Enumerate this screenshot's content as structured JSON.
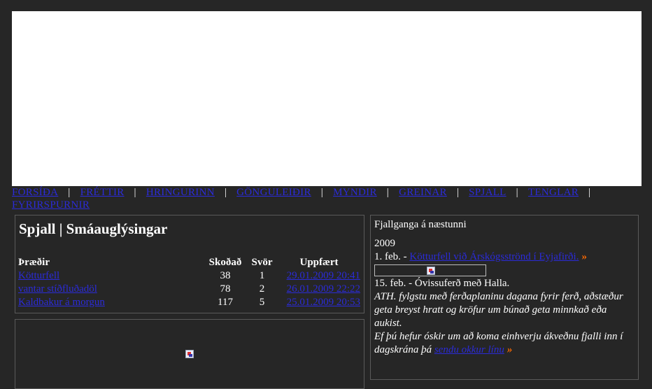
{
  "nav": {
    "items": [
      "FORSÍÐA",
      "FRÉTTIR",
      "HRINGURINN",
      "GÖNGULEIÐIR",
      "MYNDIR",
      "GREINAR",
      "SPJALL",
      "TENGLAR",
      "FYRIRSPURNIR"
    ],
    "separator": "|"
  },
  "forum": {
    "title": "Spjall | Smáauglýsingar",
    "headers": {
      "thread": "Þræðir",
      "views": "Skoðað",
      "replies": "Svör",
      "updated": "Uppfært"
    },
    "rows": [
      {
        "thread": "Kötturfell",
        "views": "38",
        "replies": "1",
        "updated": "29.01.2009 20:41"
      },
      {
        "thread": "vantar stíðfluðadöl",
        "views": "78",
        "replies": "2",
        "updated": "26.01.2009 22:22"
      },
      {
        "thread": "Kaldbakur á morgun",
        "views": "117",
        "replies": "5",
        "updated": "25.01.2009 20:53"
      }
    ]
  },
  "sidebar": {
    "heading": "Fjallganga á næstunni",
    "year": "2009",
    "event1_date": "1. feb. -",
    "event1_link": "Kötturfell við Árskógsströnd í Eyjafirði.",
    "arrow": "»",
    "event2": "15. feb. - Óvissuferð með Halla.",
    "note1": "ATH. fylgstu með ferðaplaninu dagana fyrir ferð, aðstæður geta breyst hratt og kröfur um búnað geta minnkað eða aukist.",
    "note2_prefix": "Ef þú hefur óskir um að koma einhverju ákveðnu fjalli inn í dagskrána þá",
    "note2_link": "sendu okkur línu"
  },
  "icons": {
    "broken_image": "broken-image-icon",
    "arrow": "double-arrow-icon"
  },
  "colors": {
    "background": "#262626",
    "link": "#2b2bd8",
    "arrow": "#ff6a00",
    "banner": "#ffffff"
  }
}
